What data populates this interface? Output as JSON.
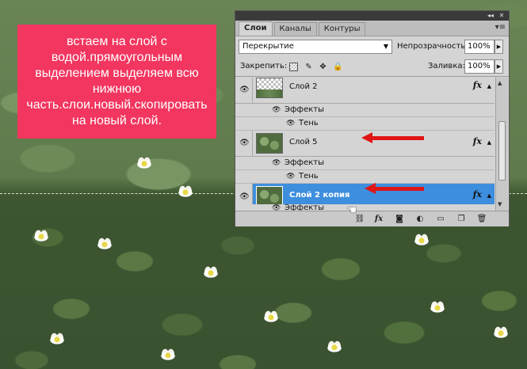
{
  "annotation": {
    "text": "встаем на слой с водой.прямоугольным выделением выделяем всю нижнюю часть.слои.новый.скопировать на новый слой."
  },
  "panel": {
    "tabs": [
      {
        "label": "Слои",
        "active": true
      },
      {
        "label": "Каналы",
        "active": false
      },
      {
        "label": "Контуры",
        "active": false
      }
    ],
    "blend_mode": "Перекрытие",
    "opacity_label": "Непрозрачность:",
    "opacity_value": "100%",
    "lock_label": "Закрепить:",
    "fill_label": "Заливка:",
    "fill_value": "100%",
    "layers": [
      {
        "name": "Слой 2",
        "thumb": "checker",
        "selected": false,
        "effects_label": "Эффекты",
        "effect": "Тень",
        "fx": "fx"
      },
      {
        "name": "Слой 5",
        "thumb": "green",
        "selected": false,
        "effects_label": "Эффекты",
        "effect": "Тень",
        "fx": "fx"
      },
      {
        "name": "Слой 2 копия",
        "thumb": "green",
        "selected": true,
        "effects_label": "Эффекты",
        "fx": "fx"
      }
    ],
    "bottom_icons": [
      "link-icon",
      "fx-icon",
      "mask-icon",
      "adjustment-icon",
      "group-icon",
      "new-layer-icon",
      "trash-icon"
    ]
  },
  "colors": {
    "note_bg": "#f2365f",
    "selection": "#3e8ede",
    "arrow": "#e01515"
  }
}
